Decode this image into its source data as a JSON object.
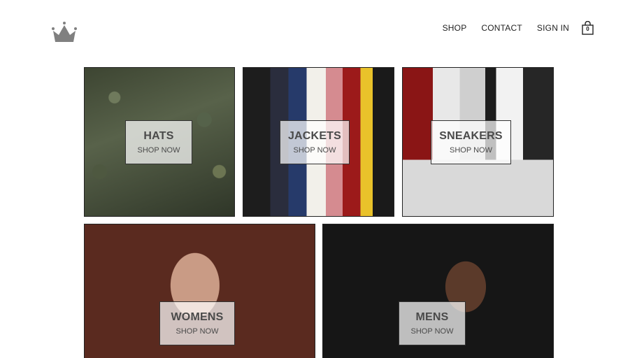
{
  "header": {
    "logo_icon": "crown-icon",
    "nav": [
      "SHOP",
      "CONTACT",
      "SIGN IN"
    ],
    "cart": {
      "icon": "shopping-bag-icon",
      "count": "0"
    }
  },
  "categories": [
    {
      "title": "HATS",
      "cta": "SHOP NOW"
    },
    {
      "title": "JACKETS",
      "cta": "SHOP NOW"
    },
    {
      "title": "SNEAKERS",
      "cta": "SHOP NOW"
    },
    {
      "title": "WOMENS",
      "cta": "SHOP NOW"
    },
    {
      "title": "MENS",
      "cta": "SHOP NOW"
    }
  ],
  "colors": {
    "border": "#222222",
    "text": "#4a4a4a",
    "background": "#ffffff"
  }
}
